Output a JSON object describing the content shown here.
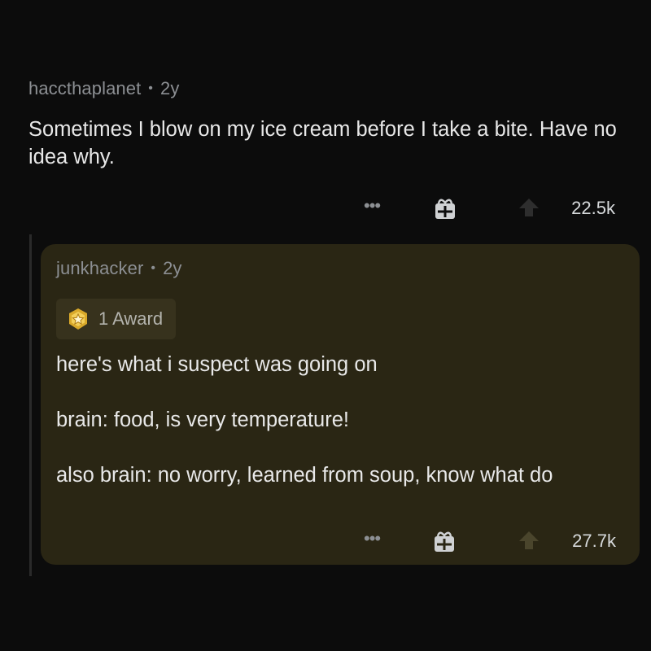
{
  "post_comment": {
    "username": "haccthaplanet",
    "separator": "•",
    "age": "2y",
    "body": "Sometimes I blow on my ice cream before I take a bite. Have no idea why.",
    "more_label": "•••",
    "score": "22.5k"
  },
  "reply_comment": {
    "username": "junkhacker",
    "separator": "•",
    "age": "2y",
    "award_label": "1 Award",
    "paragraphs": [
      "here's what i suspect was going on",
      "brain: food, is very temperature!",
      "also brain: no worry, learned from soup, know what do"
    ],
    "more_label": "•••",
    "score": "27.7k"
  },
  "icons": {
    "more": "more-options-icon",
    "gift": "gift-icon",
    "upvote": "upvote-arrow-icon",
    "award": "gold-award-icon"
  },
  "colors": {
    "background": "#0c0c0c",
    "highlight": "#2a2614",
    "award_chip": "#37321d",
    "text": "#e8e8e8",
    "muted": "#8c8f93",
    "award_gold": "#d9a92a"
  }
}
